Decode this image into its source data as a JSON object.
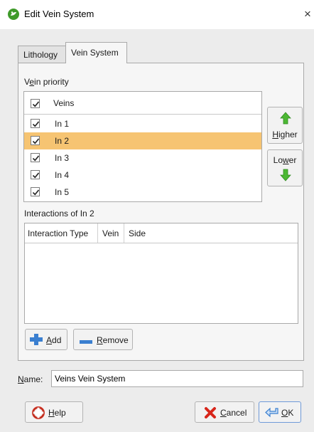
{
  "window": {
    "title": "Edit Vein System",
    "close_glyph": "×",
    "app_icon": "leapfrog-icon"
  },
  "tabs": [
    {
      "label": "Lithology",
      "active": false
    },
    {
      "label": "Vein System",
      "active": true
    }
  ],
  "vein_priority": {
    "label_prefix": "V",
    "label_underline": "e",
    "label_rest": "in priority",
    "header_checked": true,
    "column_header": "Veins",
    "rows": [
      {
        "label": "In 1",
        "checked": true,
        "selected": false
      },
      {
        "label": "In 2",
        "checked": true,
        "selected": true
      },
      {
        "label": "In 3",
        "checked": true,
        "selected": false
      },
      {
        "label": "In 4",
        "checked": true,
        "selected": false
      },
      {
        "label": "In 5",
        "checked": true,
        "selected": false
      }
    ],
    "selected_color": "#f6c472"
  },
  "higher_button": {
    "underline": "H",
    "rest": "igher",
    "icon": "arrow-up-icon"
  },
  "lower_button": {
    "prefix": "Lo",
    "underline": "w",
    "rest": "er",
    "icon": "arrow-down-icon"
  },
  "interactions": {
    "label": "Interactions of In 2",
    "columns": [
      "Interaction Type",
      "Vein",
      "Side"
    ],
    "rows": []
  },
  "add_button": {
    "underline": "A",
    "rest": "dd",
    "icon": "plus-icon"
  },
  "remove_button": {
    "underline": "R",
    "rest": "emove",
    "icon": "minus-icon"
  },
  "name_field": {
    "label_underline": "N",
    "label_rest": "ame:",
    "value": "Veins Vein System"
  },
  "help_button": {
    "underline": "H",
    "rest": "elp",
    "icon": "lifebuoy-icon"
  },
  "cancel_button": {
    "underline": "C",
    "rest": "ancel",
    "icon": "red-x-icon"
  },
  "ok_button": {
    "underline": "O",
    "rest": "K",
    "icon": "return-arrow-icon"
  },
  "colors": {
    "accent_green": "#3f9a2a",
    "selection": "#f6c472",
    "dialog_bg": "#ececec"
  }
}
